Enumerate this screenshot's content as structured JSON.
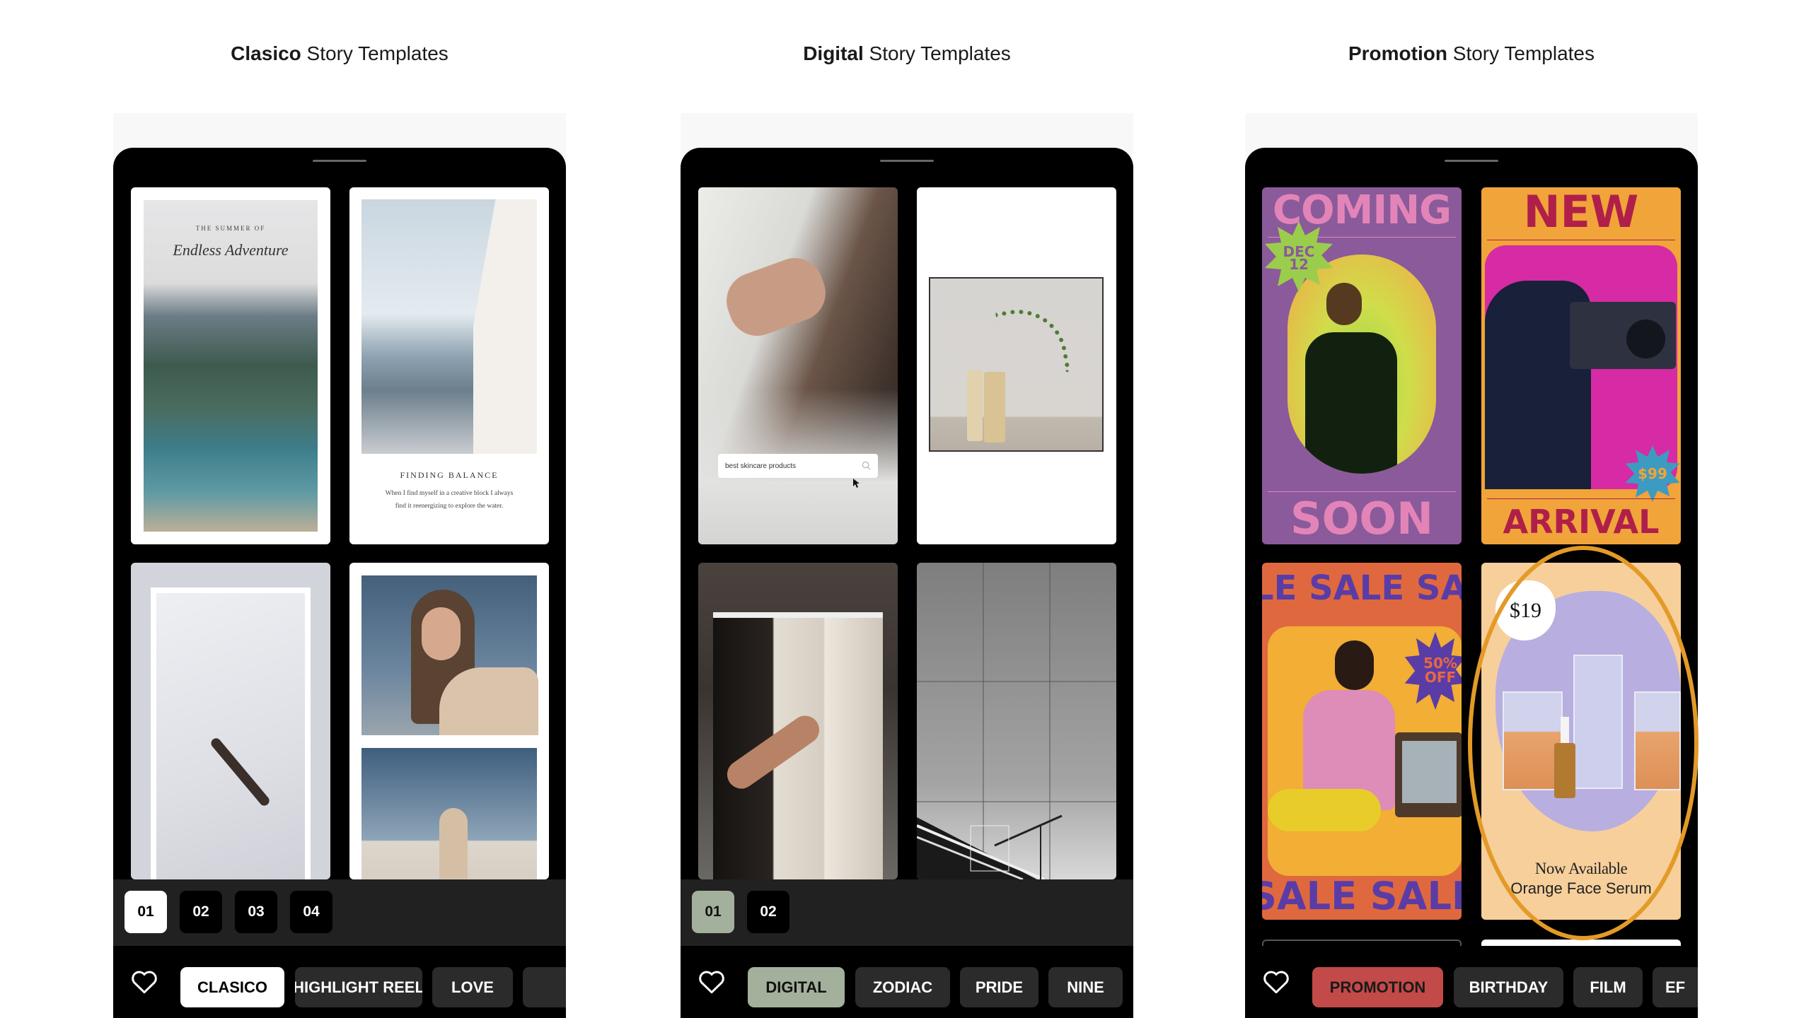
{
  "columns": [
    {
      "heading_bold": "Clasico",
      "heading_rest": " Story Templates",
      "cards": {
        "c1_small": "THE SUMMER OF",
        "c1_script": "Endless Adventure",
        "c2_title": "FINDING BALANCE",
        "c2_line1": "When I find myself in a creative block I always",
        "c2_line2": "find it reenergizing to explore the water."
      },
      "pages": [
        "01",
        "02",
        "03",
        "04"
      ],
      "active_page": "01",
      "categories": [
        "CLASICO",
        "HIGHLIGHT REEL",
        "LOVE"
      ],
      "active_category": "CLASICO"
    },
    {
      "heading_bold": "Digital",
      "heading_rest": " Story Templates",
      "cards": {
        "search_text": "best skincare products"
      },
      "pages": [
        "01",
        "02"
      ],
      "active_page": "01",
      "categories": [
        "DIGITAL",
        "ZODIAC",
        "PRIDE",
        "NINE"
      ],
      "active_category": "DIGITAL"
    },
    {
      "heading_bold": "Promotion",
      "heading_rest": " Story Templates",
      "cards": {
        "coming": "COMING",
        "soon": "SOON",
        "dec": "DEC",
        "day": "12",
        "new": "NEW",
        "arrival": "ARRIVAL",
        "price99": "$99",
        "sale_top": "LE SALE SA",
        "sale_bottom": "SALE SALE",
        "off1": "50%",
        "off2": "OFF",
        "price19": "$19",
        "now_available": "Now Available",
        "product": "Orange Face Serum"
      },
      "categories": [
        "PROMOTION",
        "BIRTHDAY",
        "FILM",
        "EF"
      ],
      "active_category": "PROMOTION"
    }
  ],
  "colors": {
    "digital_accent": "#a3b09b",
    "promotion_accent": "#c24a48",
    "annotation_ring": "#e39a27"
  }
}
